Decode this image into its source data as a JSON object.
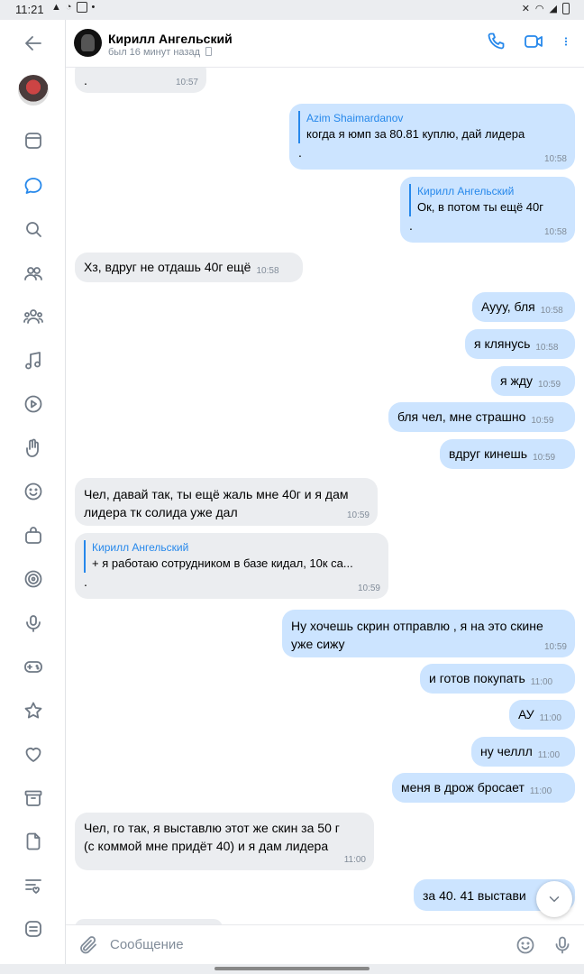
{
  "status_bar": {
    "time": "11:21"
  },
  "header": {
    "name": "Кирилл Ангельский",
    "status": "был 16 минут назад"
  },
  "messages": [
    {
      "dir": "in",
      "text": ".",
      "time": "10:57"
    },
    {
      "dir": "out",
      "reply": {
        "name": "Azim Shaimardanov",
        "text": "когда я юмп за 80.81 куплю, дай лидера"
      },
      "text": ".",
      "time": "10:58"
    },
    {
      "dir": "out",
      "reply": {
        "name": "Кирилл Ангельский",
        "text": "Ок, в потом ты ещё 40г"
      },
      "text": ".",
      "time": "10:58"
    },
    {
      "dir": "in",
      "text": "Хз, вдруг не отдашь 40г ещё",
      "time": "10:58"
    },
    {
      "dir": "out",
      "text": "Аууу, бля",
      "time": "10:58"
    },
    {
      "dir": "out",
      "text": "я клянусь",
      "time": "10:58"
    },
    {
      "dir": "out",
      "text": "я жду",
      "time": "10:59"
    },
    {
      "dir": "out",
      "text": "бля чел, мне страшно",
      "time": "10:59"
    },
    {
      "dir": "out",
      "text": "вдруг кинешь",
      "time": "10:59"
    },
    {
      "dir": "in",
      "text": "Чел, давай так, ты ещё жаль мне 40г и я дам\nлидера тк солида уже дал",
      "time": "10:59"
    },
    {
      "dir": "in",
      "reply": {
        "name": "Кирилл Ангельский",
        "text": "+ я работаю сотрудником в базе кидал, 10к са..."
      },
      "text": ".",
      "time": "10:59"
    },
    {
      "dir": "out",
      "text": "Ну хочешь скрин отправлю , я на это скине\nуже сижу",
      "time": "10:59"
    },
    {
      "dir": "out",
      "text": "и готов покупать",
      "time": "11:00"
    },
    {
      "dir": "out",
      "text": "АУ",
      "time": "11:00"
    },
    {
      "dir": "out",
      "text": "ну челлл",
      "time": "11:00"
    },
    {
      "dir": "out",
      "text": "меня в дрож бросает",
      "time": "11:00"
    },
    {
      "dir": "in",
      "text": "Чел, го так, я выставлю этот же скин за 50 г\n(с коммой мне придёт 40) и я дам лидера",
      "time": "11:00"
    },
    {
      "dir": "out",
      "text": "за 40. 41 выстави",
      "time": ""
    }
  ],
  "composer": {
    "placeholder": "Сообщение"
  },
  "colors": {
    "accent": "#2688eb",
    "outgoing_bubble": "#cce4ff",
    "incoming_bubble": "#ebedf0"
  },
  "rail_icons": [
    "back-arrow-icon",
    "profile-avatar",
    "news-icon",
    "messages-icon",
    "search-icon",
    "friends-icon",
    "communities-icon",
    "music-icon",
    "video-icon",
    "clips-icon",
    "stickers-icon",
    "market-icon",
    "services-icon",
    "podcasts-icon",
    "games-icon",
    "favorites-icon",
    "likes-icon",
    "archive-icon",
    "documents-icon",
    "lists-icon",
    "menu-icon"
  ]
}
